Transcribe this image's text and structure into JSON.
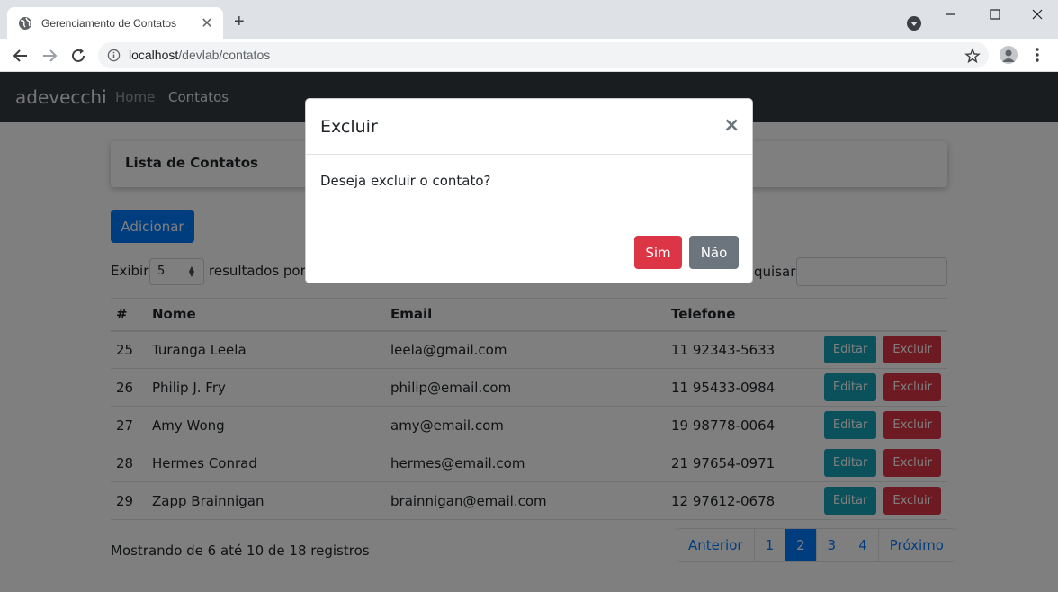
{
  "browser": {
    "tab_title": "Gerenciamento de Contatos",
    "tab_close": "✕",
    "new_tab": "+",
    "url_host": "localhost",
    "url_path": "/devlab/contatos"
  },
  "navbar": {
    "brand": "adevecchi",
    "links": [
      "Home",
      "Contatos"
    ]
  },
  "card": {
    "title": "Lista de Contatos"
  },
  "toolbar": {
    "add_label": "Adicionar",
    "show_label": "Exibir",
    "page_size": "5",
    "results_label": "resultados por",
    "search_label": "quisar"
  },
  "table": {
    "headers": [
      "#",
      "Nome",
      "Email",
      "Telefone"
    ],
    "edit_label": "Editar",
    "delete_label": "Excluir",
    "rows": [
      {
        "id": "25",
        "name": "Turanga Leela",
        "email": "leela@gmail.com",
        "phone": "11 92343-5633"
      },
      {
        "id": "26",
        "name": "Philip J. Fry",
        "email": "philip@email.com",
        "phone": "11 95433-0984"
      },
      {
        "id": "27",
        "name": "Amy Wong",
        "email": "amy@email.com",
        "phone": "19 98778-0064"
      },
      {
        "id": "28",
        "name": "Hermes Conrad",
        "email": "hermes@email.com",
        "phone": "21 97654-0971"
      },
      {
        "id": "29",
        "name": "Zapp Brainnigan",
        "email": "brainnigan@email.com",
        "phone": "12 97612-0678"
      }
    ]
  },
  "footer": {
    "showing": "Mostrando de 6 até 10 de 18 registros",
    "pagination": [
      "Anterior",
      "1",
      "2",
      "3",
      "4",
      "Próximo"
    ],
    "active_page": "2"
  },
  "modal": {
    "title": "Excluir",
    "close": "×",
    "message": "Deseja excluir o contato?",
    "yes_label": "Sim",
    "no_label": "Não"
  },
  "colors": {
    "primary": "#007bff",
    "danger": "#dc3545",
    "info": "#17a2b8",
    "secondary": "#6c757d",
    "navbar": "#343a40"
  }
}
